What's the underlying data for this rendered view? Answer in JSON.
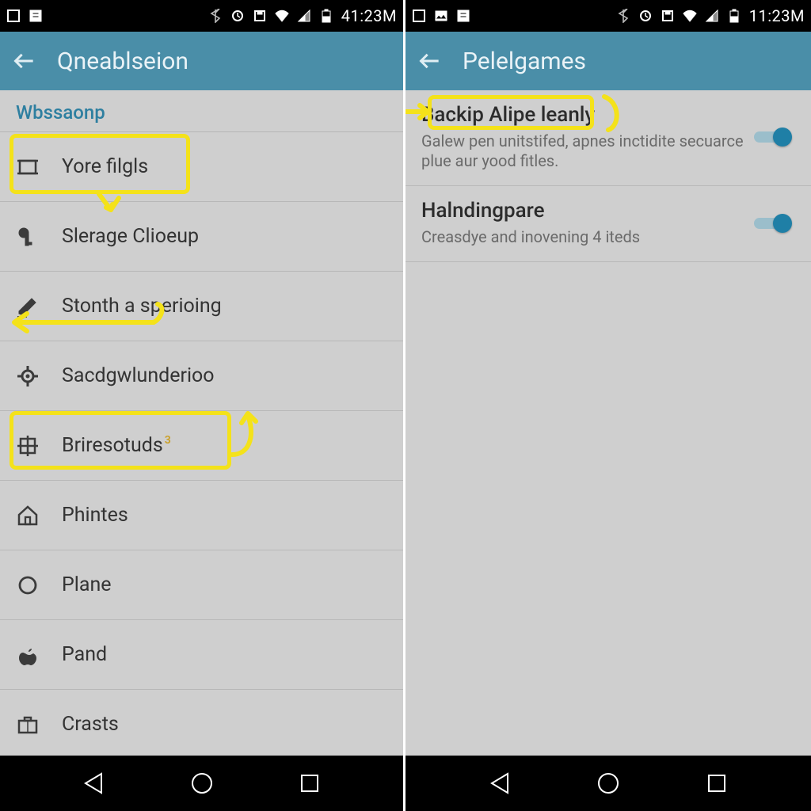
{
  "left": {
    "status": {
      "time": "41:23M"
    },
    "appbar": {
      "title": "Qneablseion"
    },
    "section": "Wbssaonp",
    "items": [
      {
        "icon": "frame-icon",
        "label": "Yore  filgls",
        "badge": ""
      },
      {
        "icon": "key-icon",
        "label": "Slerage Clioeup"
      },
      {
        "icon": "pen-icon",
        "label": "Stonth a sperioing"
      },
      {
        "icon": "target-icon",
        "label": "Sacdgwlunderioo"
      },
      {
        "icon": "grid-icon",
        "label": "Briresotuds",
        "badge": "3"
      },
      {
        "icon": "home-icon",
        "label": "Phintes"
      },
      {
        "icon": "circle-icon",
        "label": "Plane"
      },
      {
        "icon": "apple-icon",
        "label": "Pand"
      },
      {
        "icon": "case-icon",
        "label": "Crasts"
      }
    ]
  },
  "right": {
    "status": {
      "time": "11:23M"
    },
    "appbar": {
      "title": "Pelelgames"
    },
    "settings": [
      {
        "title": "Backip Alipe  leanly",
        "desc": "Galew pen unitstifed, apnes inctidite secuarce plue aur yood fitles.",
        "on": true
      },
      {
        "title": "Halndingpare",
        "desc": "Creasdye and inovening\n4 iteds",
        "on": true
      }
    ]
  }
}
